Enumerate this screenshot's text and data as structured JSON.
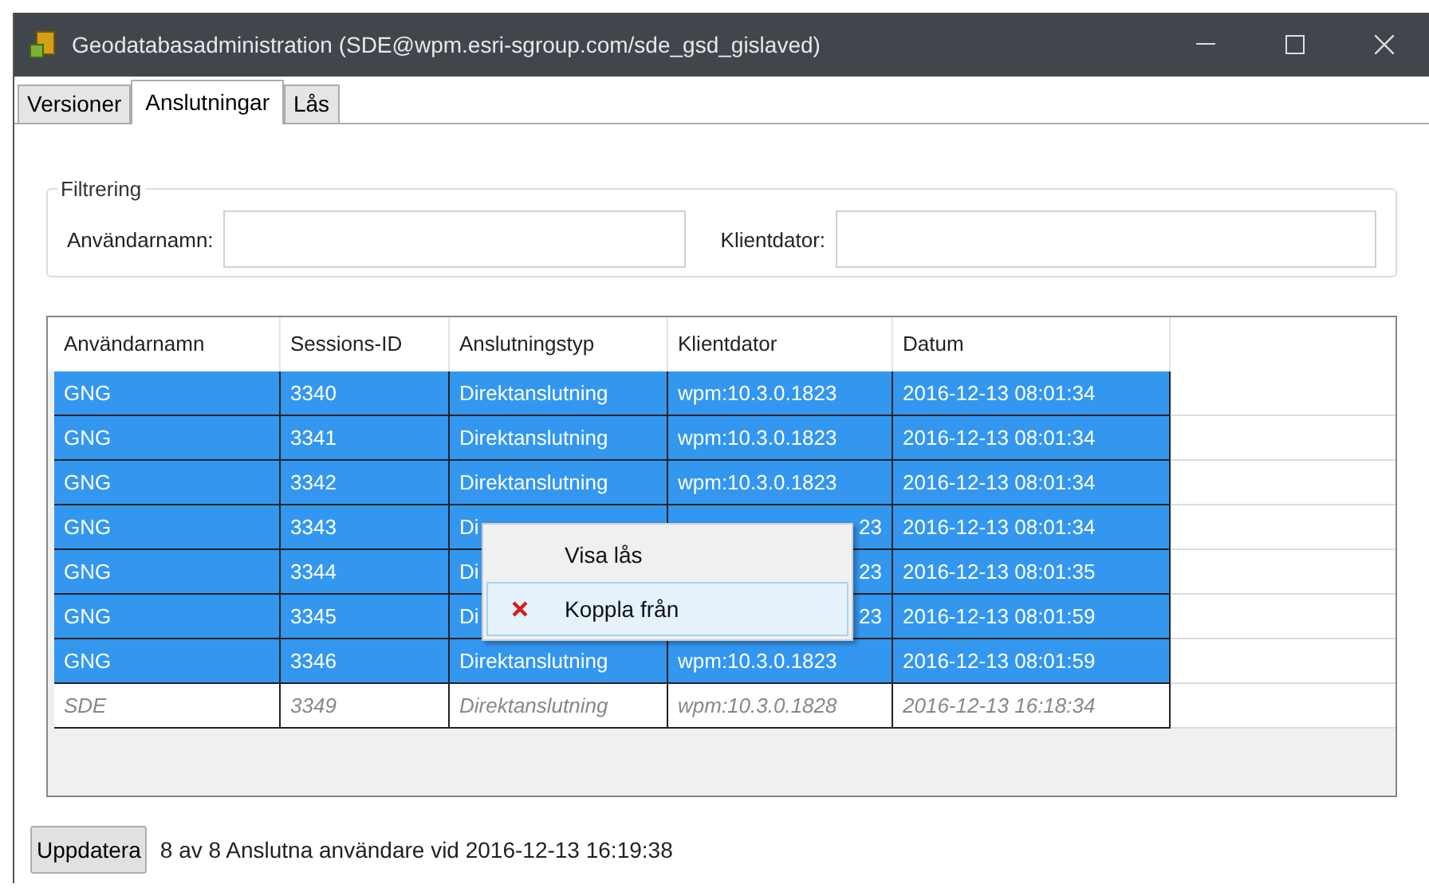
{
  "window": {
    "title": "Geodatabasadministration (SDE@wpm.esri-sgroup.com/sde_gsd_gislaved)"
  },
  "tabs": [
    {
      "label": "Versioner",
      "selected": false
    },
    {
      "label": "Anslutningar",
      "selected": true
    },
    {
      "label": "Lås",
      "selected": false
    }
  ],
  "filter": {
    "title": "Filtrering",
    "fields": [
      {
        "label": "Användarnamn:"
      },
      {
        "label": "Klientdator:"
      }
    ]
  },
  "table": {
    "columns": [
      "Användarnamn",
      "Sessions-ID",
      "Anslutningstyp",
      "Klientdator",
      "Datum"
    ],
    "rows": [
      {
        "cells": [
          "GNG",
          "3340",
          "Direktanslutning",
          "wpm:10.3.0.1823",
          "2016-12-13 08:01:34"
        ],
        "selected": true,
        "current": false
      },
      {
        "cells": [
          "GNG",
          "3341",
          "Direktanslutning",
          "wpm:10.3.0.1823",
          "2016-12-13 08:01:34"
        ],
        "selected": true,
        "current": false
      },
      {
        "cells": [
          "GNG",
          "3342",
          "Direktanslutning",
          "wpm:10.3.0.1823",
          "2016-12-13 08:01:34"
        ],
        "selected": true,
        "current": false
      },
      {
        "cells": [
          "GNG",
          "3343",
          "Di",
          "23",
          "2016-12-13 08:01:34"
        ],
        "selected": true,
        "current": false
      },
      {
        "cells": [
          "GNG",
          "3344",
          "Di",
          "23",
          "2016-12-13 08:01:35"
        ],
        "selected": true,
        "current": false
      },
      {
        "cells": [
          "GNG",
          "3345",
          "Di",
          "23",
          "2016-12-13 08:01:59"
        ],
        "selected": true,
        "current": false
      },
      {
        "cells": [
          "GNG",
          "3346",
          "Direktanslutning",
          "wpm:10.3.0.1823",
          "2016-12-13 08:01:59"
        ],
        "selected": true,
        "current": false
      },
      {
        "cells": [
          "SDE",
          "3349",
          "Direktanslutning",
          "wpm:10.3.0.1828",
          "2016-12-13 16:18:34"
        ],
        "selected": false,
        "current": true
      }
    ]
  },
  "context_menu": {
    "items": [
      {
        "label": "Visa lås",
        "kind": "plain",
        "selected": false
      },
      {
        "label": "Koppla från",
        "kind": "disconnect",
        "selected": true
      }
    ]
  },
  "footer": {
    "button": "Uppdatera",
    "status": "8 av 8 Anslutna användare vid 2016-12-13 16:19:38"
  }
}
